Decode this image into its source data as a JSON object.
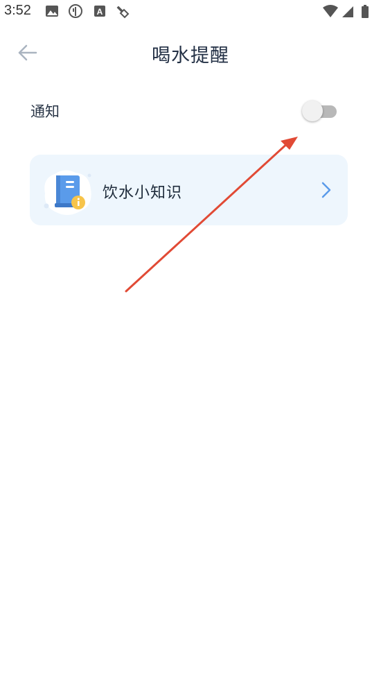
{
  "status_bar": {
    "time": "3:52",
    "left_icons": [
      "image-icon",
      "antenna-icon",
      "text-a-icon",
      "settings-wrench-icon"
    ],
    "right_icons": [
      "wifi-icon",
      "signal-icon",
      "battery-icon"
    ]
  },
  "header": {
    "title": "喝水提醒",
    "back_icon": "arrow-left-icon"
  },
  "notification": {
    "label": "通知",
    "enabled": false
  },
  "knowledge_card": {
    "label": "饮水小知识",
    "icon": "book-info-icon",
    "chevron_icon": "chevron-right-icon"
  },
  "colors": {
    "accent": "#5a9bea",
    "card_bg": "#eef6fd",
    "annotation_arrow": "#e14a35"
  }
}
